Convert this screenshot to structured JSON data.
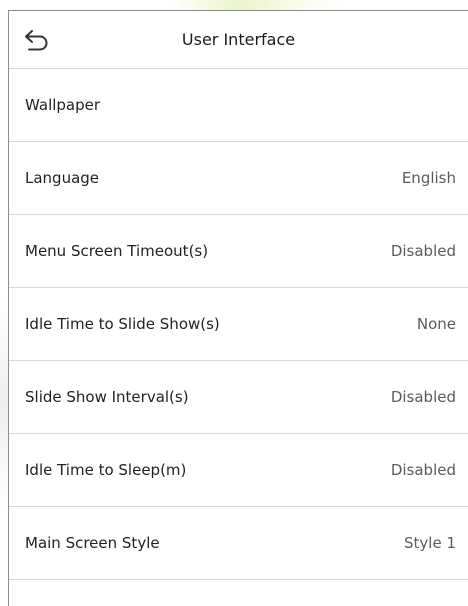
{
  "header": {
    "title": "User Interface",
    "back_icon": "undo-arrow-icon"
  },
  "menu": {
    "items": [
      {
        "label": "Wallpaper",
        "value": ""
      },
      {
        "label": "Language",
        "value": "English"
      },
      {
        "label": "Menu Screen Timeout(s)",
        "value": "Disabled"
      },
      {
        "label": "Idle Time to Slide Show(s)",
        "value": "None"
      },
      {
        "label": "Slide Show Interval(s)",
        "value": "Disabled"
      },
      {
        "label": "Idle Time to Sleep(m)",
        "value": "Disabled"
      },
      {
        "label": "Main Screen Style",
        "value": "Style 1"
      }
    ]
  },
  "colors": {
    "background": "#ffffff",
    "divider": "#d8d8d8",
    "frame": "#8c8c8c",
    "text": "#222222",
    "value_text": "#5a5a5a"
  }
}
